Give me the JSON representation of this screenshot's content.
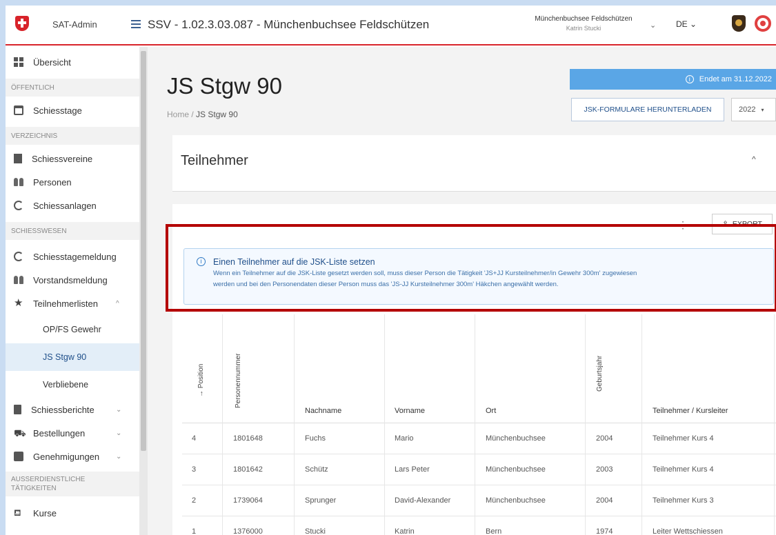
{
  "header": {
    "app_name": "SAT-Admin",
    "page_title": "SSV - 1.02.3.03.087 - Münchenbuchsee Feldschützen",
    "user_club": "Münchenbuchsee Feldschützen",
    "user_name": "Katrin Stucki",
    "language": "DE ⌄"
  },
  "sidebar": {
    "overview": "Übersicht",
    "section_public": "ÖFFENTLICH",
    "schiesstage": "Schiesstage",
    "section_directory": "VERZEICHNIS",
    "schiessvereine": "Schiessvereine",
    "personen": "Personen",
    "schiessanlagen": "Schiessanlagen",
    "section_shooting": "SCHIESSWESEN",
    "schiesstagemeldung": "Schiesstagemeldung",
    "vorstandsmeldung": "Vorstandsmeldung",
    "teilnehmerlisten": "Teilnehmerlisten",
    "sub_opfs": "OP/FS Gewehr",
    "sub_js": "JS Stgw 90",
    "sub_verbliebene": "Verbliebene",
    "schiessberichte": "Schiessberichte",
    "bestellungen": "Bestellungen",
    "genehmigungen": "Genehmigungen",
    "section_extra_1": "AUSSERDIENSTLICHE",
    "section_extra_2": "TÄTIGKEITEN",
    "kurse": "Kurse"
  },
  "main": {
    "title": "JS Stgw 90",
    "breadcrumb_home": "Home",
    "breadcrumb_sep": "/",
    "breadcrumb_current": "JS Stgw 90",
    "ends_notice": "Endet am 31.12.2022",
    "download_button": "JSK-FORMULARE HERUNTERLADEN",
    "year": "2022",
    "participants_title": "Teilnehmer",
    "export_button": "EXPORT",
    "hint_title": "Einen Teilnehmer auf die JSK-Liste setzen",
    "hint_line1": "Wenn ein Teilnehmer auf die JSK-Liste gesetzt werden soll, muss dieser Person die Tätigkeit 'JS+JJ Kursteilnehmer/in Gewehr 300m' zugewiesen",
    "hint_line2": "werden und bei den Personendaten dieser Person muss das 'JS-JJ Kursteilnehmer 300m' Häkchen angewählt werden."
  },
  "table": {
    "headers": {
      "position": "Position",
      "personennummer": "Personennummer",
      "nachname": "Nachname",
      "vorname": "Vorname",
      "ort": "Ort",
      "geburtsjahr": "Geburtsjahr",
      "rolle": "Teilnehmer / Kursleiter"
    },
    "rows": [
      {
        "pos": "4",
        "nr": "1801648",
        "nachname": "Fuchs",
        "vorname": "Mario",
        "ort": "Münchenbuchsee",
        "jahr": "2004",
        "rolle": "Teilnehmer Kurs 4"
      },
      {
        "pos": "3",
        "nr": "1801642",
        "nachname": "Schütz",
        "vorname": "Lars Peter",
        "ort": "Münchenbuchsee",
        "jahr": "2003",
        "rolle": "Teilnehmer Kurs 4"
      },
      {
        "pos": "2",
        "nr": "1739064",
        "nachname": "Sprunger",
        "vorname": "David-Alexander",
        "ort": "Münchenbuchsee",
        "jahr": "2004",
        "rolle": "Teilnehmer Kurs 3"
      },
      {
        "pos": "1",
        "nr": "1376000",
        "nachname": "Stucki",
        "vorname": "Katrin",
        "ort": "Bern",
        "jahr": "1974",
        "rolle": "Leiter Wettschiessen"
      }
    ]
  },
  "colors": {
    "accent_red": "#d8232a",
    "info_blue": "#5aa6e6",
    "highlight_box": "#b40000",
    "primary_blue": "#1f4f8a"
  }
}
